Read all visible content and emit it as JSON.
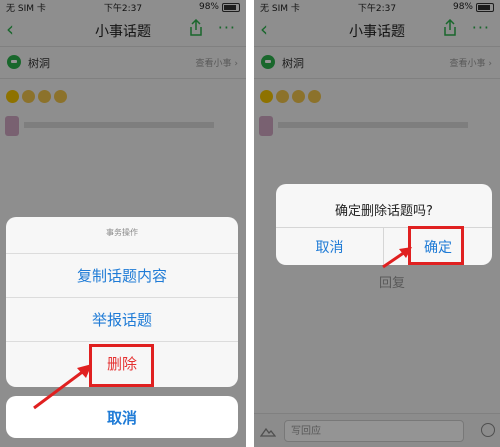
{
  "status": {
    "carrier": "无 SIM 卡",
    "time": "下午2:37",
    "battery": "98%"
  },
  "nav": {
    "back": "‹",
    "title": "小事话题",
    "more": "···"
  },
  "topic": {
    "name": "树洞",
    "link": "查看小事 ›"
  },
  "action_sheet": {
    "title": "事务操作",
    "items": [
      "复制话题内容",
      "举报话题",
      "删除"
    ],
    "cancel": "取消"
  },
  "dialog": {
    "title": "确定删除话题吗?",
    "cancel": "取消",
    "confirm": "确定"
  },
  "reply": {
    "label": "回复",
    "placeholder": "写回应"
  },
  "colors": {
    "accent_green": "#2bb24c",
    "ios_blue": "#1f7bd6",
    "danger_red": "#e53232",
    "annotation_red": "#e02020"
  }
}
